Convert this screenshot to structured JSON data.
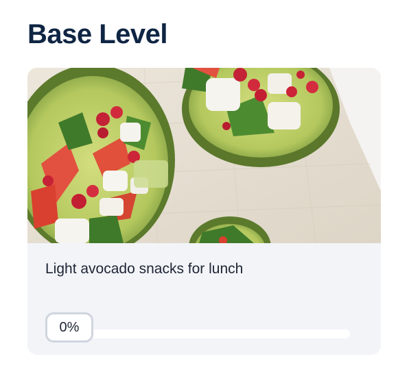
{
  "page": {
    "title": "Base Level"
  },
  "card": {
    "image_icon": "avocado-salad-photo",
    "caption": "Light avocado snacks for lunch",
    "progress": {
      "value": 0,
      "label": "0%"
    }
  },
  "colors": {
    "title": "#0f2543",
    "card_background": "#f2f4f8",
    "track": "#ffffff",
    "badge_border": "#cfd5de"
  }
}
